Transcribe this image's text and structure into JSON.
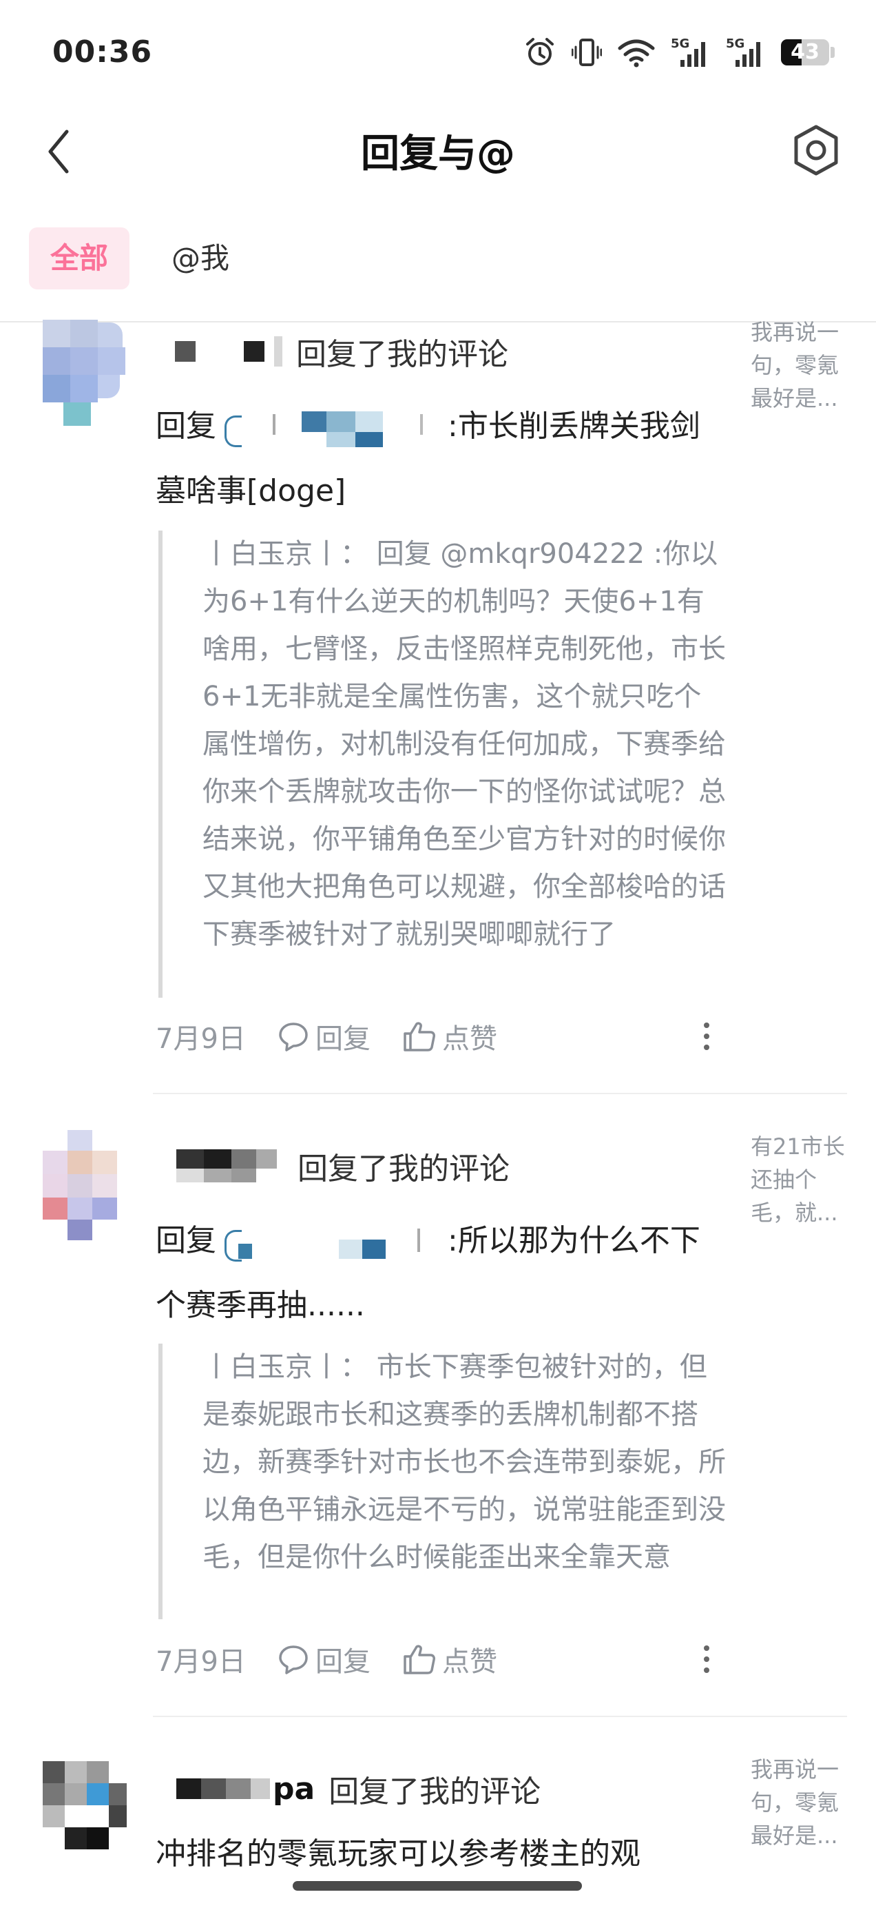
{
  "status_bar": {
    "time": "00:36",
    "battery_level": "43",
    "battery_fraction": 0.43,
    "network_1": "5G",
    "network_2": "5G"
  },
  "header": {
    "title": "回复与@"
  },
  "tabs": [
    {
      "label": "全部",
      "active": true
    },
    {
      "label": "@我",
      "active": false
    }
  ],
  "notifications": [
    {
      "action": "回复了我的评论",
      "preview": "我再说一句，零氪最好是...",
      "content_prefix": "回复",
      "content_text": ":市长削丢牌关我剑墓啥事[doge]",
      "quote": "丨白玉京丨：  回复 @mkqr904222 :你以为6+1有什么逆天的机制吗？天使6+1有啥用，七臂怪，反击怪照样克制死他，市长6+1无非就是全属性伤害，这个就只吃个属性增伤，对机制没有任何加成，下赛季给你来个丢牌就攻击你一下的怪你试试呢？总结来说，你平铺角色至少官方针对的时候你又其他大把角色可以规避，你全部梭哈的话下赛季被针对了就别哭唧唧就行了",
      "date": "7月9日",
      "reply_label": "回复",
      "like_label": "点赞"
    },
    {
      "action": "回复了我的评论",
      "preview": "有21市长还抽个毛，就...",
      "content_prefix": "回复",
      "content_text": ":所以那为什么不下个赛季再抽......",
      "quote": "丨白玉京丨：  市长下赛季包被针对的，但是泰妮跟市长和这赛季的丢牌机制都不搭边，新赛季针对市长也不会连带到泰妮，所以角色平铺永远是不亏的，说常驻能歪到没毛，但是你什么时候能歪出来全靠天意",
      "date": "7月9日",
      "reply_label": "回复",
      "like_label": "点赞"
    },
    {
      "name_suffix": "pa",
      "action": "回复了我的评论",
      "preview": "我再说一句，零氪最好是...",
      "content_text": "冲排名的零氪玩家可以参考楼主的观"
    }
  ]
}
